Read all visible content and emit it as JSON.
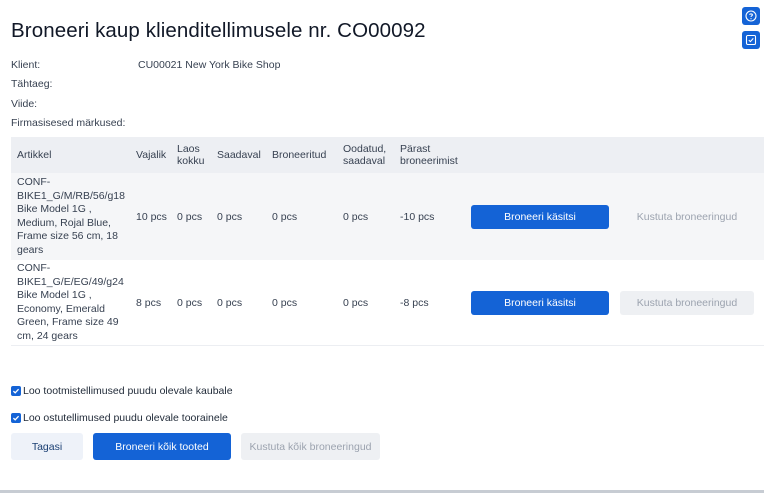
{
  "title": "Broneeri kaup klienditellimusele nr. CO00092",
  "side_buttons": [
    {
      "icon": "help-circle-icon"
    },
    {
      "icon": "checkbox-icon"
    }
  ],
  "meta": [
    {
      "label": "Klient:",
      "value": "CU00021 New York Bike Shop"
    },
    {
      "label": "Tähtaeg:",
      "value": ""
    },
    {
      "label": "Viide:",
      "value": ""
    },
    {
      "label": "Firmasisesed märkused:",
      "value": ""
    }
  ],
  "table": {
    "headers": {
      "article": "Artikkel",
      "required": "Vajalik",
      "in_stock_line1": "Laos",
      "in_stock_line2": "kokku",
      "available": "Saadaval",
      "reserved": "Broneeritud",
      "expected_line1": "Oodatud,",
      "expected_line2": "saadaval",
      "after_line1": "Pärast",
      "after_line2": "broneerimist"
    },
    "rows": [
      {
        "article_lines": [
          "CONF-",
          "BIKE1_G/M/RB/56/g18",
          "Bike Model 1G ,",
          "Medium, Rojal Blue,",
          "Frame size 56 cm, 18",
          "gears"
        ],
        "required": "10 pcs",
        "in_stock": "0 pcs",
        "available": "0 pcs",
        "reserved": "0 pcs",
        "expected": "0 pcs",
        "after": "-10 pcs",
        "reserve_label": "Broneeri käsitsi",
        "delete_label": "Kustuta broneeringud"
      },
      {
        "article_lines": [
          "CONF-",
          "BIKE1_G/E/EG/49/g24",
          "Bike Model 1G ,",
          "Economy, Emerald",
          "Green, Frame size 49",
          "cm, 24 gears"
        ],
        "required": "8 pcs",
        "in_stock": "0 pcs",
        "available": "0 pcs",
        "reserved": "0 pcs",
        "expected": "0 pcs",
        "after": "-8 pcs",
        "reserve_label": "Broneeri käsitsi",
        "delete_label": "Kustuta broneeringud"
      }
    ]
  },
  "checkboxes": [
    {
      "label": "Loo tootmistellimused puudu olevale kaubale",
      "checked": true
    },
    {
      "label": "Loo ostutellimused puudu olevale toorainele",
      "checked": true
    }
  ],
  "footer": {
    "back_label": "Tagasi",
    "reserve_all_label": "Broneeri kõik tooted",
    "delete_all_label": "Kustuta kõik broneeringud"
  },
  "colors": {
    "primary": "#1463d6",
    "header_bg": "#edeff3",
    "disabled_bg": "#eef0f3"
  }
}
